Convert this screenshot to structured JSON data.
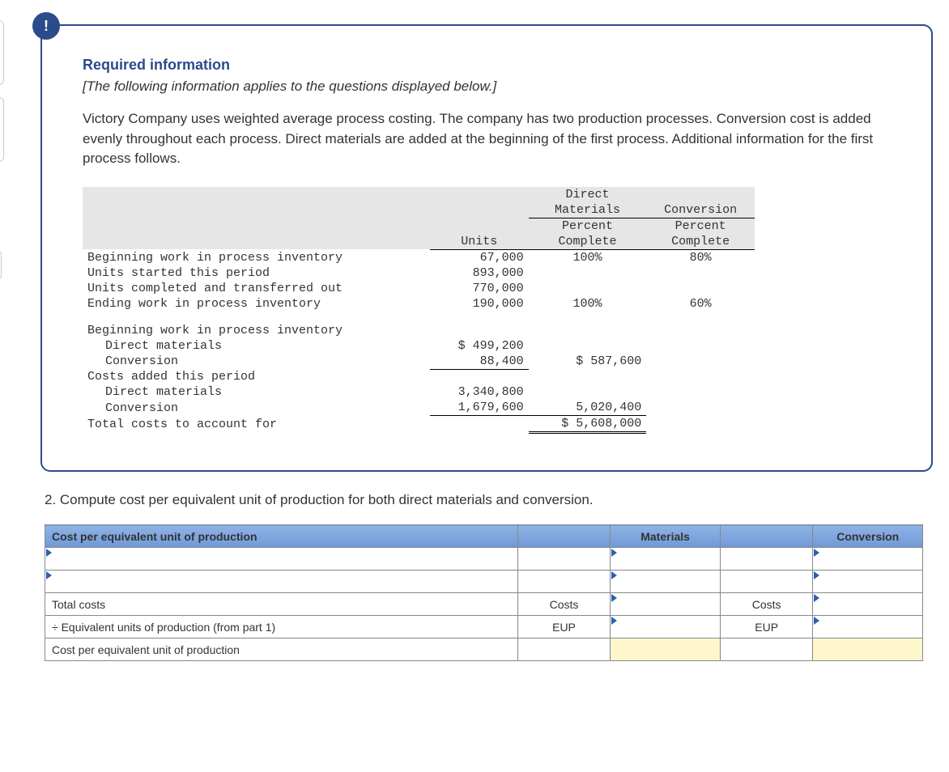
{
  "panel": {
    "badge": "!",
    "required_title": "Required information",
    "italic_note": "[The following information applies to the questions displayed below.]",
    "intro": "Victory Company uses weighted average process costing. The company has two production processes. Conversion cost is added evenly throughout each process. Direct materials are added at the beginning of the first process. Additional information for the first process follows."
  },
  "part_badge": "2",
  "info_headers": {
    "dm_line1": "Direct",
    "dm_line2": "Materials",
    "conv": "Conversion",
    "pct": "Percent",
    "units": "Units",
    "complete": "Complete"
  },
  "units_rows": [
    {
      "label": "Beginning work in process inventory",
      "units": "67,000",
      "dm": "100%",
      "conv": "80%"
    },
    {
      "label": "Units started this period",
      "units": "893,000",
      "dm": "",
      "conv": ""
    },
    {
      "label": "Units completed and transferred out",
      "units": "770,000",
      "dm": "",
      "conv": ""
    },
    {
      "label": "Ending work in process inventory",
      "units": "190,000",
      "dm": "100%",
      "conv": "60%"
    }
  ],
  "cost_section": {
    "bwip": "Beginning work in process inventory",
    "bwip_dm_label": "Direct materials",
    "bwip_dm": "$ 499,200",
    "bwip_cv_label": "Conversion",
    "bwip_cv": "88,400",
    "bwip_sub": "$ 587,600",
    "added": "Costs added this period",
    "added_dm_label": "Direct materials",
    "added_dm": "3,340,800",
    "added_cv_label": "Conversion",
    "added_cv": "1,679,600",
    "added_sub": "5,020,400",
    "total_label": "Total costs to account for",
    "total": "$ 5,608,000"
  },
  "question2": "2. Compute cost per equivalent unit of production for both direct materials and conversion.",
  "ans": {
    "title": "Cost per equivalent unit of production",
    "materials": "Materials",
    "conversion": "Conversion",
    "total_costs": "Total costs",
    "costs": "Costs",
    "eup_row": "÷ Equivalent units of production (from part 1)",
    "eup": "EUP",
    "cpe": "Cost per equivalent unit of production"
  }
}
